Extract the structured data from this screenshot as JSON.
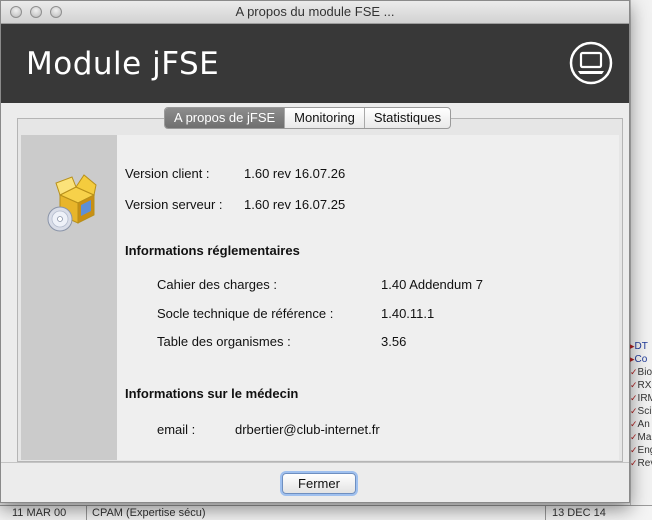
{
  "window": {
    "title": "A propos du module FSE ...",
    "header_title": "Module jFSE",
    "header_icon": "computer-icon"
  },
  "tabs": [
    {
      "label": "A propos de jFSE",
      "active": true
    },
    {
      "label": "Monitoring",
      "active": false
    },
    {
      "label": "Statistiques",
      "active": false
    }
  ],
  "about": {
    "icon": "software-package-icon",
    "version_client_label": "Version client :",
    "version_client_value": "1.60 rev 16.07.26",
    "version_server_label": "Version serveur :",
    "version_server_value": "1.60 rev 16.07.25",
    "regulatory_heading": "Informations réglementaires",
    "regulatory": [
      {
        "label": "Cahier des charges :",
        "value": "1.40 Addendum 7"
      },
      {
        "label": "Socle technique de référence :",
        "value": "1.40.11.1"
      },
      {
        "label": "Table des organismes :",
        "value": "3.56"
      }
    ],
    "doctor_heading": "Informations sur le médecin",
    "email_label": "email :",
    "email_value": "drbertier@club-internet.fr"
  },
  "buttons": {
    "close_label": "Fermer"
  },
  "background": {
    "right_list": [
      "DT",
      "Co",
      "Bio",
      "RX",
      "IRM",
      "Sci",
      "An",
      "Ma",
      "Eng",
      "Rev"
    ],
    "bottom_row": {
      "date_left": "11 MAR 00",
      "description": "CPAM  (Expertise sécu)",
      "date_right": "13 DEC 14"
    }
  },
  "colors": {
    "header_bg": "#383838",
    "tab_active": "#7a7a7a",
    "bg_teal": "#3f6d72"
  }
}
